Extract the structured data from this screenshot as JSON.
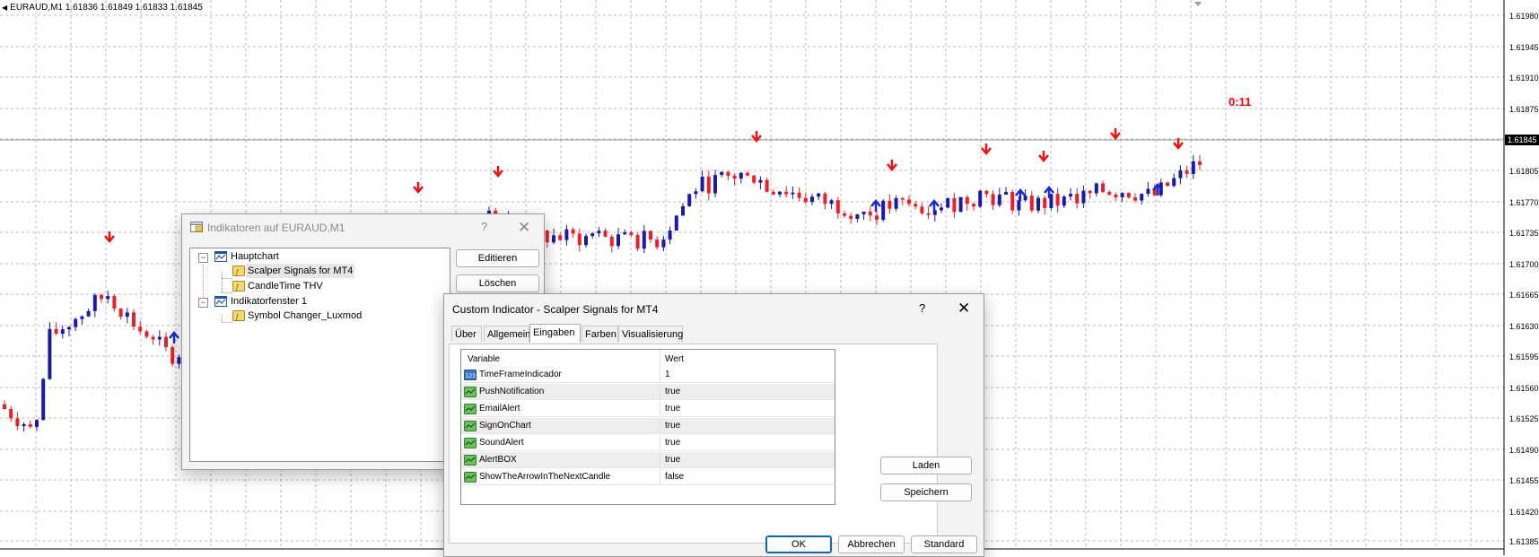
{
  "chart": {
    "header": "EURAUD,M1  1.61836 1.61849 1.61833 1.61845",
    "countdown": "0:11",
    "current_price": "1.61845",
    "price_levels": [
      "1.61980",
      "1.61945",
      "1.61910",
      "1.61875",
      "1.61805",
      "1.61770",
      "1.61735",
      "1.61700",
      "1.61665",
      "1.61630",
      "1.61595",
      "1.61560",
      "1.61525",
      "1.61490",
      "1.61455",
      "1.61420",
      "1.61385"
    ],
    "colors": {
      "bull": "#1a1aa8",
      "bear": "#e8202a",
      "grid": "#b9b9b9",
      "signal_up": "#1a28d8",
      "signal_down": "#ee1111"
    }
  },
  "indicators_dialog": {
    "title": "Indikatoren auf EURAUD,M1",
    "help": "?",
    "close": "✕",
    "tree": {
      "main": "Hauptchart",
      "main_items": [
        "Scalper Signals for MT4",
        "CandleTime THV"
      ],
      "sub": "Indikatorfenster 1",
      "sub_items": [
        "Symbol Changer_Luxmod"
      ]
    },
    "buttons": {
      "edit": "Editieren",
      "delete": "Löschen"
    }
  },
  "custom_dialog": {
    "title": "Custom Indicator - Scalper Signals for MT4",
    "help": "?",
    "close": "✕",
    "tabs": [
      "Über",
      "Allgemein",
      "Eingaben",
      "Farben",
      "Visualisierung"
    ],
    "active_tab": "Eingaben",
    "columns": {
      "variable": "Variable",
      "value": "Wert"
    },
    "rows": [
      {
        "name": "TimeFrameIndicador",
        "value": "1",
        "icon": "int-icon"
      },
      {
        "name": "PushNotification",
        "value": "true",
        "icon": "bool-icon"
      },
      {
        "name": "EmailAlert",
        "value": "true",
        "icon": "bool-icon"
      },
      {
        "name": "SignOnChart",
        "value": "true",
        "icon": "bool-icon"
      },
      {
        "name": "SoundAlert",
        "value": "true",
        "icon": "bool-icon"
      },
      {
        "name": "AlertBOX",
        "value": "true",
        "icon": "bool-icon"
      },
      {
        "name": "ShowTheArrowInTheNextCandle",
        "value": "false",
        "icon": "bool-icon"
      }
    ],
    "buttons": {
      "load": "Laden",
      "save": "Speichern",
      "ok": "OK",
      "cancel": "Abbrechen",
      "default": "Standard"
    }
  }
}
